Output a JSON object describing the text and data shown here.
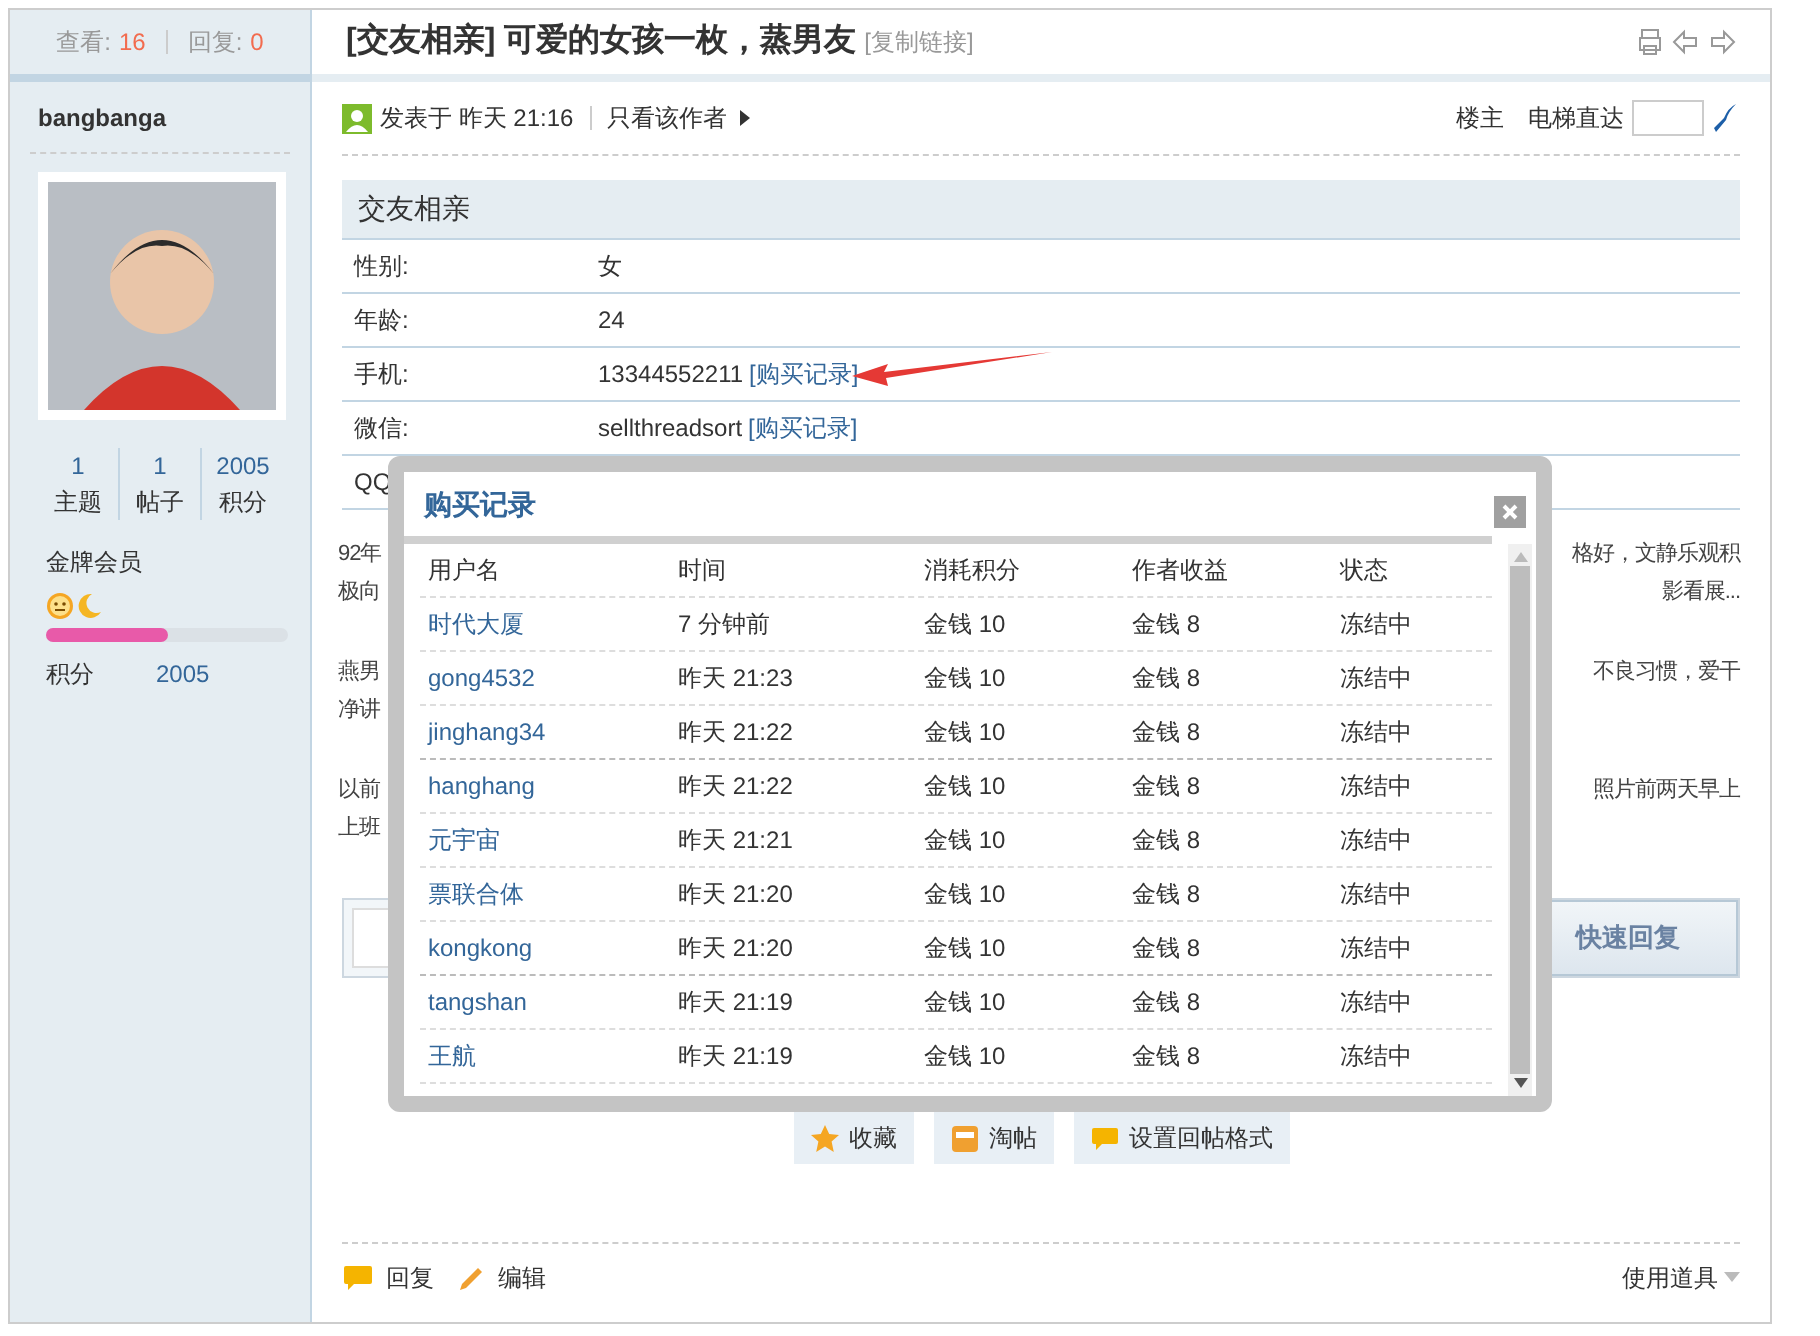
{
  "sidebar": {
    "views_label": "查看:",
    "views": "16",
    "replies_label": "回复:",
    "replies": "0",
    "username": "bangbanga",
    "stats": [
      {
        "value": "1",
        "label": "主题"
      },
      {
        "value": "1",
        "label": "帖子"
      },
      {
        "value": "2005",
        "label": "积分"
      }
    ],
    "group": "金牌会员",
    "level": 0.5,
    "points_label": "积分",
    "points": "2005"
  },
  "thread": {
    "tag": "[交友相亲]",
    "title": "可爱的女孩一枚，蒸男友",
    "copy_link": "[复制链接]"
  },
  "post_meta": {
    "posted": "发表于 昨天 21:16",
    "only_author": "只看该作者",
    "floor": "楼主",
    "jump_label": "电梯直达"
  },
  "info_table": {
    "title": "交友相亲",
    "rows": [
      {
        "label": "性别:",
        "value": "女"
      },
      {
        "label": "年龄:",
        "value": "24"
      },
      {
        "label": "手机:",
        "value": "13344552211",
        "link": "[购买记录]"
      },
      {
        "label": "微信:",
        "value": "sellthreadsort",
        "link": "[购买记录]"
      },
      {
        "label": "QQ"
      }
    ]
  },
  "post_paragraphs": [
    {
      "lines": [
        {
          "left": "92年",
          "right": "格好，文静乐观积"
        },
        {
          "left": "极向",
          "right": "影看展..."
        }
      ]
    },
    {
      "lines": [
        {
          "left": "燕男",
          "right": "不良习惯，爱干"
        },
        {
          "left": "净讲"
        }
      ]
    },
    {
      "lines": [
        {
          "left": "以前",
          "right": "照片前两天早上"
        },
        {
          "left": "上班"
        }
      ]
    }
  ],
  "quick_reply": "快速回复",
  "actions": [
    "收藏",
    "淘帖",
    "设置回帖格式"
  ],
  "footer": {
    "reply": "回复",
    "edit": "编辑",
    "tools": "使用道具"
  },
  "modal": {
    "title": "购买记录",
    "columns": [
      "用户名",
      "时间",
      "消耗积分",
      "作者收益",
      "状态"
    ],
    "rows": [
      [
        "时代大厦",
        "7 分钟前",
        "金钱 10",
        "金钱 8",
        "冻结中"
      ],
      [
        "gong4532",
        "昨天 21:23",
        "金钱 10",
        "金钱 8",
        "冻结中"
      ],
      [
        "jinghang34",
        "昨天 21:22",
        "金钱 10",
        "金钱 8",
        "冻结中"
      ],
      [
        "hanghang",
        "昨天 21:22",
        "金钱 10",
        "金钱 8",
        "冻结中"
      ],
      [
        "元宇宙",
        "昨天 21:21",
        "金钱 10",
        "金钱 8",
        "冻结中"
      ],
      [
        "票联合体",
        "昨天 21:20",
        "金钱 10",
        "金钱 8",
        "冻结中"
      ],
      [
        "kongkong",
        "昨天 21:20",
        "金钱 10",
        "金钱 8",
        "冻结中"
      ],
      [
        "tangshan",
        "昨天 21:19",
        "金钱 10",
        "金钱 8",
        "冻结中"
      ],
      [
        "王航",
        "昨天 21:19",
        "金钱 10",
        "金钱 8",
        "冻结中"
      ]
    ]
  }
}
